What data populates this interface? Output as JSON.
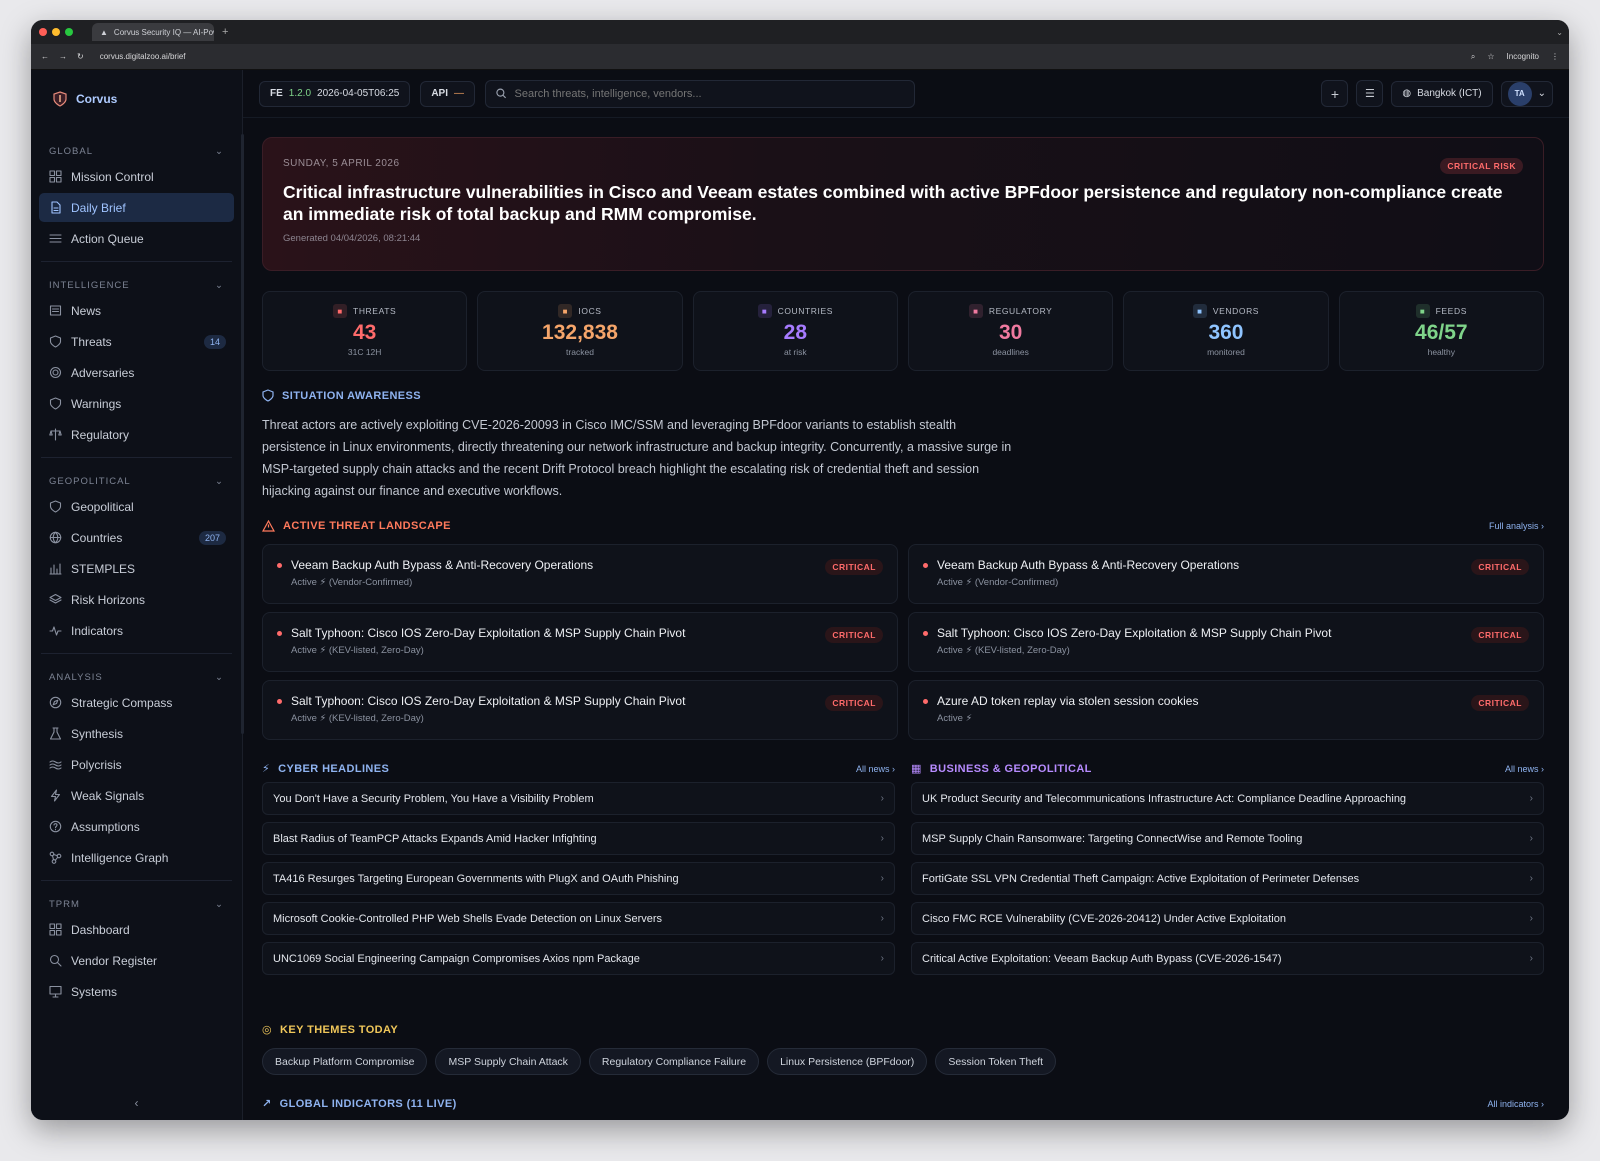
{
  "browser": {
    "tab_title": "Corvus Security IQ — AI-Pow",
    "url": "corvus.digitalzoo.ai/brief",
    "incognito_label": "Incognito"
  },
  "brand": {
    "name": "Corvus"
  },
  "sidebar": {
    "sections": [
      {
        "title": "GLOBAL",
        "items": [
          {
            "label": "Mission Control",
            "icon": "grid-icon"
          },
          {
            "label": "Daily Brief",
            "icon": "document-icon",
            "active": true
          },
          {
            "label": "Action Queue",
            "icon": "list-icon"
          }
        ]
      },
      {
        "title": "INTELLIGENCE",
        "items": [
          {
            "label": "News",
            "icon": "newspaper-icon"
          },
          {
            "label": "Threats",
            "icon": "shield-icon",
            "badge": "14"
          },
          {
            "label": "Adversaries",
            "icon": "target-icon"
          },
          {
            "label": "Warnings",
            "icon": "shield-icon"
          },
          {
            "label": "Regulatory",
            "icon": "scale-icon"
          }
        ]
      },
      {
        "title": "GEOPOLITICAL",
        "items": [
          {
            "label": "Geopolitical",
            "icon": "shield-icon"
          },
          {
            "label": "Countries",
            "icon": "globe-icon",
            "badge": "207"
          },
          {
            "label": "STEMPLES",
            "icon": "bar-chart-icon"
          },
          {
            "label": "Risk Horizons",
            "icon": "layers-icon"
          },
          {
            "label": "Indicators",
            "icon": "pulse-icon"
          }
        ]
      },
      {
        "title": "ANALYSIS",
        "items": [
          {
            "label": "Strategic Compass",
            "icon": "compass-icon"
          },
          {
            "label": "Synthesis",
            "icon": "flask-icon"
          },
          {
            "label": "Polycrisis",
            "icon": "waves-icon"
          },
          {
            "label": "Weak Signals",
            "icon": "bolt-icon"
          },
          {
            "label": "Assumptions",
            "icon": "help-icon"
          },
          {
            "label": "Intelligence Graph",
            "icon": "graph-icon"
          }
        ]
      },
      {
        "title": "TPRM",
        "items": [
          {
            "label": "Dashboard",
            "icon": "grid-icon"
          },
          {
            "label": "Vendor Register",
            "icon": "search-icon"
          },
          {
            "label": "Systems",
            "icon": "monitor-icon"
          }
        ]
      }
    ]
  },
  "topbar": {
    "fe_label": "FE",
    "version": "1.2.0",
    "timestamp": "2026-04-05T06:25",
    "api_label": "API",
    "api_status": "—",
    "search_placeholder": "Search threats, intelligence, vendors...",
    "timezone": "Bangkok (ICT)",
    "avatar_initials": "TA"
  },
  "hero": {
    "date": "SUNDAY, 5 APRIL 2026",
    "risk_badge": "CRITICAL RISK",
    "headline": "Critical infrastructure vulnerabilities in Cisco and Veeam estates combined with active BPFdoor persistence and regulatory non-compliance create an immediate risk of total backup and RMM compromise.",
    "generated": "Generated 04/04/2026, 08:21:44"
  },
  "stats": [
    {
      "label": "THREATS",
      "value": "43",
      "sub": "31C 12H",
      "color": "#ff6b6b",
      "icon": "alert-triangle-icon"
    },
    {
      "label": "IOCS",
      "value": "132,838",
      "sub": "tracked",
      "color": "#f5a56a",
      "icon": "database-icon"
    },
    {
      "label": "COUNTRIES",
      "value": "28",
      "sub": "at risk",
      "color": "#a77bff",
      "icon": "globe-icon"
    },
    {
      "label": "REGULATORY",
      "value": "30",
      "sub": "deadlines",
      "color": "#f07aa0",
      "icon": "document-icon"
    },
    {
      "label": "VENDORS",
      "value": "360",
      "sub": "monitored",
      "color": "#8fc4ff",
      "icon": "users-icon"
    },
    {
      "label": "FEEDS",
      "value": "46/57",
      "sub": "healthy",
      "color": "#7fd48a",
      "icon": "pulse-icon"
    }
  ],
  "situation": {
    "title": "SITUATION AWARENESS",
    "text": "Threat actors are actively exploiting CVE-2026-20093 in Cisco IMC/SSM and leveraging BPFdoor variants to establish stealth persistence in Linux environments, directly threatening our network infrastructure and backup integrity. Concurrently, a massive surge in MSP-targeted supply chain attacks and the recent Drift Protocol breach highlight the escalating risk of credential theft and session hijacking against our finance and executive workflows."
  },
  "threat_landscape": {
    "title": "ACTIVE THREAT LANDSCAPE",
    "link": "Full analysis ›",
    "items": [
      {
        "title": "Veeam Backup Auth Bypass & Anti-Recovery Operations",
        "status": "Active ⚡ (Vendor-Confirmed)",
        "badge": "CRITICAL"
      },
      {
        "title": "Veeam Backup Auth Bypass & Anti-Recovery Operations",
        "status": "Active ⚡ (Vendor-Confirmed)",
        "badge": "CRITICAL"
      },
      {
        "title": "Salt Typhoon: Cisco IOS Zero-Day Exploitation & MSP Supply Chain Pivot",
        "status": "Active ⚡ (KEV-listed, Zero-Day)",
        "badge": "CRITICAL"
      },
      {
        "title": "Salt Typhoon: Cisco IOS Zero-Day Exploitation & MSP Supply Chain Pivot",
        "status": "Active ⚡ (KEV-listed, Zero-Day)",
        "badge": "CRITICAL"
      },
      {
        "title": "Salt Typhoon: Cisco IOS Zero-Day Exploitation & MSP Supply Chain Pivot",
        "status": "Active ⚡ (KEV-listed, Zero-Day)",
        "badge": "CRITICAL"
      },
      {
        "title": "Azure AD token replay via stolen session cookies",
        "status": "Active ⚡",
        "badge": "CRITICAL"
      }
    ]
  },
  "cyber": {
    "title": "CYBER HEADLINES",
    "link": "All news ›",
    "items": [
      "You Don't Have a Security Problem, You Have a Visibility Problem",
      "Blast Radius of TeamPCP Attacks Expands Amid Hacker Infighting",
      "TA416 Resurges Targeting European Governments with PlugX and OAuth Phishing",
      "Microsoft Cookie-Controlled PHP Web Shells Evade Detection on Linux Servers",
      "UNC1069 Social Engineering Campaign Compromises Axios npm Package"
    ]
  },
  "business": {
    "title": "BUSINESS & GEOPOLITICAL",
    "link": "All news ›",
    "items": [
      "UK Product Security and Telecommunications Infrastructure Act: Compliance Deadline Approaching",
      "MSP Supply Chain Ransomware: Targeting ConnectWise and Remote Tooling",
      "FortiGate SSL VPN Credential Theft Campaign: Active Exploitation of Perimeter Defenses",
      "Cisco FMC RCE Vulnerability (CVE-2026-20412) Under Active Exploitation",
      "Critical Active Exploitation: Veeam Backup Auth Bypass (CVE-2026-1547)"
    ]
  },
  "themes": {
    "title": "KEY THEMES TODAY",
    "items": [
      "Backup Platform Compromise",
      "MSP Supply Chain Attack",
      "Regulatory Compliance Failure",
      "Linux Persistence (BPFdoor)",
      "Session Token Theft"
    ]
  },
  "indicators": {
    "title": "GLOBAL INDICATORS (11 LIVE)",
    "link": "All indicators ›"
  },
  "colors": {
    "accent": "#8fb3f0",
    "critical": "#ff6b6b",
    "warning_title": "#ff7a5c",
    "themes_title": "#f0c75a",
    "business_title": "#b78bff"
  }
}
